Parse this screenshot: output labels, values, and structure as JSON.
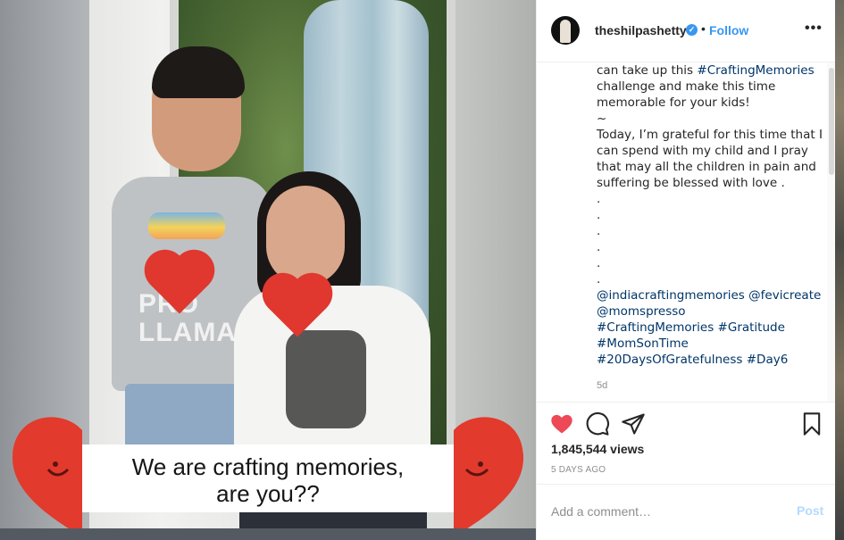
{
  "post": {
    "username": "theshilpashetty",
    "follow_label": "Follow",
    "separator": "•",
    "more_label": "•••",
    "caption_lines": [
      [
        {
          "text": "can take up this "
        },
        {
          "text": "#CraftingMemories",
          "tag": true
        }
      ],
      [
        {
          "text": "challenge and make this time"
        }
      ],
      [
        {
          "text": "memorable for your kids!"
        }
      ],
      [
        {
          "text": "~"
        }
      ],
      [
        {
          "text": "Today, I’m grateful for this time that I"
        }
      ],
      [
        {
          "text": "can spend with my child and I pray"
        }
      ],
      [
        {
          "text": "that may all the children in pain and"
        }
      ],
      [
        {
          "text": "suffering be blessed with love ."
        }
      ],
      [
        {
          "text": "."
        }
      ],
      [
        {
          "text": "."
        }
      ],
      [
        {
          "text": "."
        }
      ],
      [
        {
          "text": "."
        }
      ],
      [
        {
          "text": "."
        }
      ],
      [
        {
          "text": "."
        }
      ],
      [
        {
          "text": "@indiacraftingmemories",
          "tag": true
        },
        {
          "text": " "
        },
        {
          "text": "@fevicreate",
          "tag": true
        }
      ],
      [
        {
          "text": "@momspresso",
          "tag": true
        }
      ],
      [
        {
          "text": "#CraftingMemories",
          "tag": true
        },
        {
          "text": " "
        },
        {
          "text": "#Gratitude",
          "tag": true
        }
      ],
      [
        {
          "text": "#MomSonTime",
          "tag": true
        }
      ],
      [
        {
          "text": "#20DaysOfGratefulness",
          "tag": true
        },
        {
          "text": " "
        },
        {
          "text": "#Day6",
          "tag": true
        }
      ]
    ],
    "time_ago": "5d",
    "views": "1,845,544 views",
    "date": "5 DAYS AGO",
    "comment_placeholder": "Add a comment…",
    "post_label": "Post"
  },
  "video": {
    "overlay_line1": "We are crafting memories,",
    "overlay_line2": "are you??",
    "shirt_text_line1": "PRO",
    "shirt_text_line2": "LLAMA"
  },
  "colors": {
    "like_red": "#ed4956",
    "link_blue": "#3897f0",
    "hashtag": "#003569"
  },
  "icons": [
    "verified-icon",
    "more-options-icon",
    "heart-icon",
    "comment-icon",
    "share-icon",
    "bookmark-icon"
  ]
}
